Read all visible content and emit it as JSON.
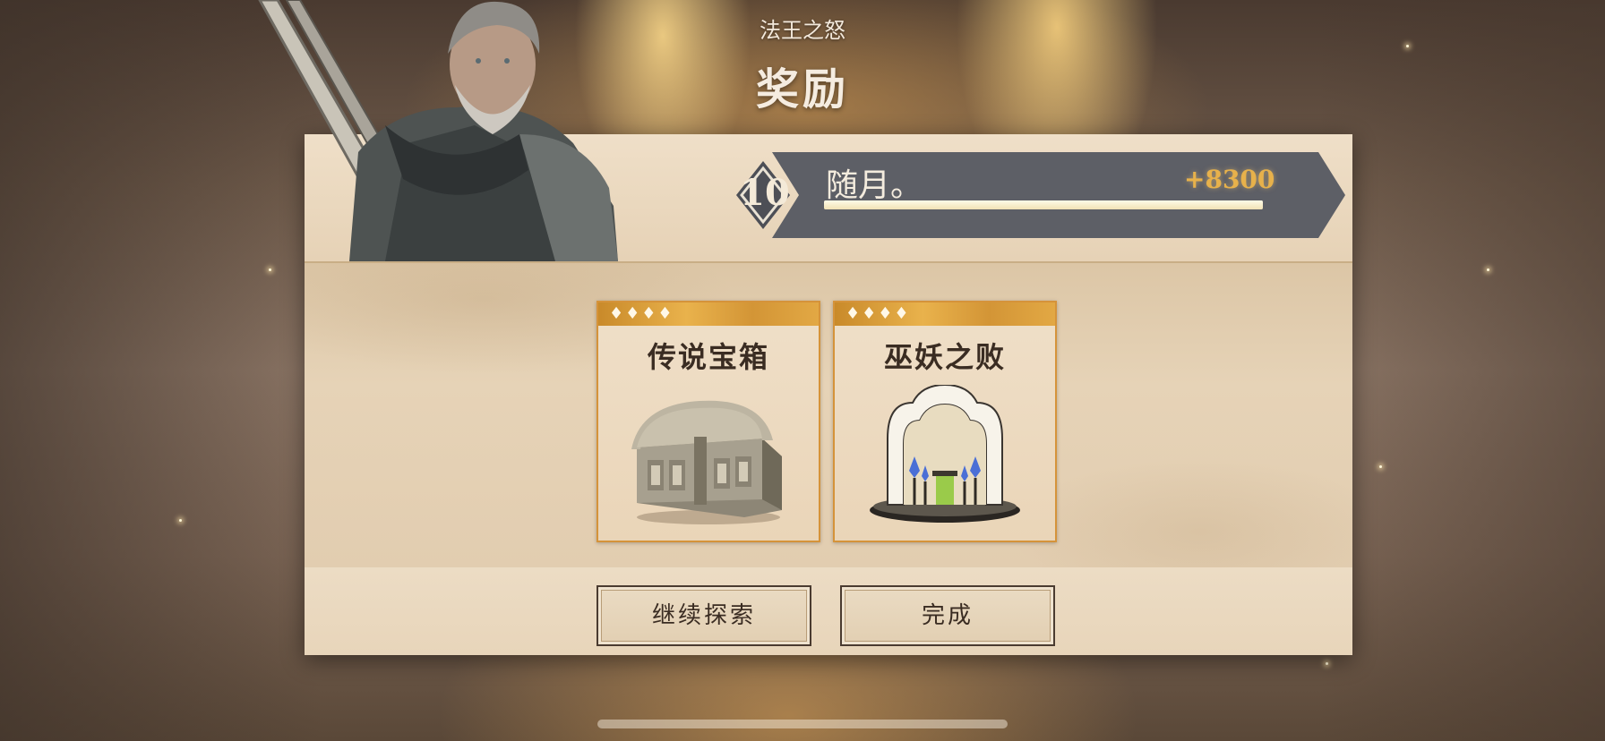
{
  "header": {
    "subtitle": "法王之怒",
    "title": "奖励"
  },
  "level_banner": {
    "level": "10",
    "name": "随月。",
    "xp_gain": "+8300",
    "xp_progress": 1.0
  },
  "rewards": [
    {
      "title": "传说宝箱",
      "stars": 4,
      "icon": "treasure-chest-icon"
    },
    {
      "title": "巫妖之败",
      "stars": 4,
      "icon": "shrine-icon"
    }
  ],
  "buttons": {
    "continue_label": "继续探索",
    "done_label": "完成"
  },
  "colors": {
    "accent_gold": "#e7b14b",
    "card_border": "#d5933a",
    "banner_slate": "#5d5f66",
    "parchment": "#ead8bf"
  }
}
